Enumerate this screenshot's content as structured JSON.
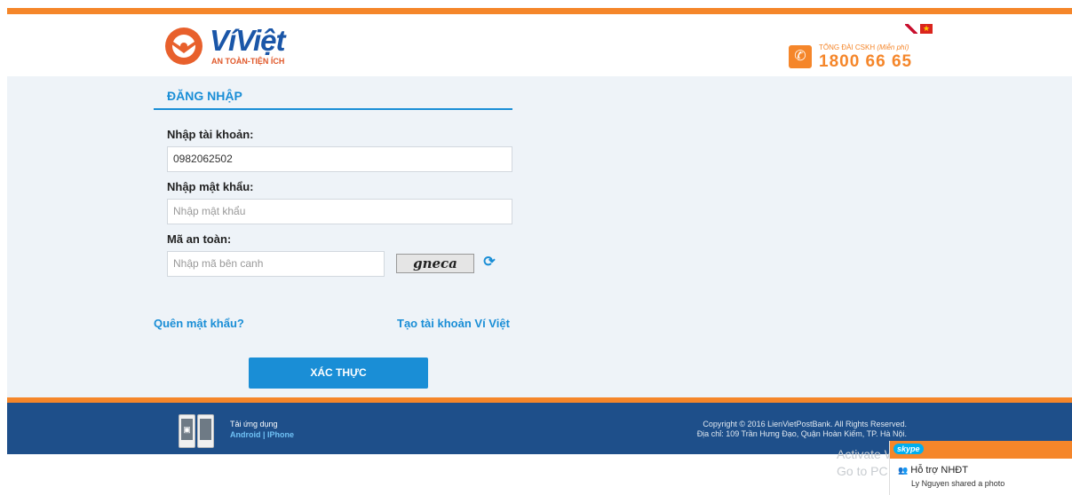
{
  "brand": {
    "name": "VíViệt",
    "tagline": "AN TOÀN-TIỆN ÍCH"
  },
  "hotline": {
    "label": "TỔNG ĐÀI CSKH",
    "label_note": "(Miễn phí)",
    "number": "1800 66 65"
  },
  "flags": [
    "uk-flag",
    "vn-flag"
  ],
  "login": {
    "title": "ĐĂNG NHẬP",
    "account_label": "Nhập tài khoản:",
    "account_value": "0982062502",
    "password_label": "Nhập mật khẩu:",
    "password_placeholder": "Nhập mật khẩu",
    "captcha_label": "Mã an toàn:",
    "captcha_placeholder": "Nhập mã bên canh",
    "captcha_text": "gneca",
    "forgot_link": "Quên mật khẩu?",
    "register_link": "Tạo tài khoản Ví Việt",
    "submit": "XÁC THỰC"
  },
  "footer": {
    "app_label": "Tải ứng dụng",
    "app_links": "Android | IPhone",
    "copyright": "Copyright © 2016 LienVietPostBank. All Rights Reserved.",
    "address": "Địa chỉ: 109 Trần Hưng Đạo, Quận Hoàn Kiếm, TP. Hà Nội."
  },
  "overlay": {
    "watermark_line1": "Activate Windows",
    "watermark_line2": "Go to PC settings to activate Windows.",
    "skype_logo": "skype",
    "skype_contact": "Hỗ trợ NHĐT",
    "skype_activity": "Ly Nguyen shared a photo"
  },
  "colors": {
    "orange": "#f5862a",
    "blue": "#1a8ed6",
    "navy": "#1e4f8a"
  }
}
